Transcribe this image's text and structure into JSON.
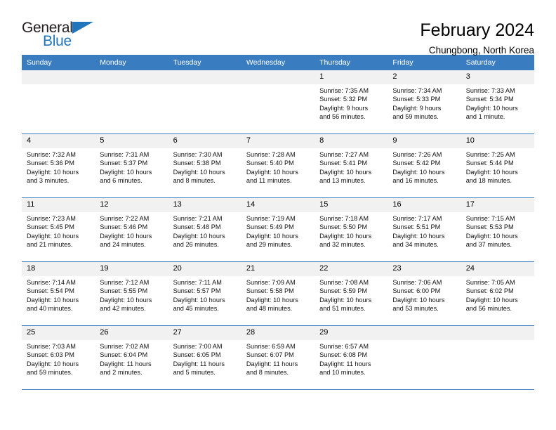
{
  "brand": {
    "name_top": "General",
    "name_bottom": "Blue",
    "triangle_color": "#2175bc"
  },
  "header": {
    "title": "February 2024",
    "subtitle": "Chungbong, North Korea"
  },
  "theme": {
    "header_blue": "#3a7cc0",
    "daynum_gray": "#f1f1f1"
  },
  "weekday_headers": [
    "Sunday",
    "Monday",
    "Tuesday",
    "Wednesday",
    "Thursday",
    "Friday",
    "Saturday"
  ],
  "weeks": [
    [
      {
        "day": "",
        "empty": true
      },
      {
        "day": "",
        "empty": true
      },
      {
        "day": "",
        "empty": true
      },
      {
        "day": "",
        "empty": true
      },
      {
        "day": "1",
        "sunrise": "Sunrise: 7:35 AM",
        "sunset": "Sunset: 5:32 PM",
        "daylight1": "Daylight: 9 hours",
        "daylight2": "and 56 minutes."
      },
      {
        "day": "2",
        "sunrise": "Sunrise: 7:34 AM",
        "sunset": "Sunset: 5:33 PM",
        "daylight1": "Daylight: 9 hours",
        "daylight2": "and 59 minutes."
      },
      {
        "day": "3",
        "sunrise": "Sunrise: 7:33 AM",
        "sunset": "Sunset: 5:34 PM",
        "daylight1": "Daylight: 10 hours",
        "daylight2": "and 1 minute."
      }
    ],
    [
      {
        "day": "4",
        "sunrise": "Sunrise: 7:32 AM",
        "sunset": "Sunset: 5:36 PM",
        "daylight1": "Daylight: 10 hours",
        "daylight2": "and 3 minutes."
      },
      {
        "day": "5",
        "sunrise": "Sunrise: 7:31 AM",
        "sunset": "Sunset: 5:37 PM",
        "daylight1": "Daylight: 10 hours",
        "daylight2": "and 6 minutes."
      },
      {
        "day": "6",
        "sunrise": "Sunrise: 7:30 AM",
        "sunset": "Sunset: 5:38 PM",
        "daylight1": "Daylight: 10 hours",
        "daylight2": "and 8 minutes."
      },
      {
        "day": "7",
        "sunrise": "Sunrise: 7:28 AM",
        "sunset": "Sunset: 5:40 PM",
        "daylight1": "Daylight: 10 hours",
        "daylight2": "and 11 minutes."
      },
      {
        "day": "8",
        "sunrise": "Sunrise: 7:27 AM",
        "sunset": "Sunset: 5:41 PM",
        "daylight1": "Daylight: 10 hours",
        "daylight2": "and 13 minutes."
      },
      {
        "day": "9",
        "sunrise": "Sunrise: 7:26 AM",
        "sunset": "Sunset: 5:42 PM",
        "daylight1": "Daylight: 10 hours",
        "daylight2": "and 16 minutes."
      },
      {
        "day": "10",
        "sunrise": "Sunrise: 7:25 AM",
        "sunset": "Sunset: 5:44 PM",
        "daylight1": "Daylight: 10 hours",
        "daylight2": "and 18 minutes."
      }
    ],
    [
      {
        "day": "11",
        "sunrise": "Sunrise: 7:23 AM",
        "sunset": "Sunset: 5:45 PM",
        "daylight1": "Daylight: 10 hours",
        "daylight2": "and 21 minutes."
      },
      {
        "day": "12",
        "sunrise": "Sunrise: 7:22 AM",
        "sunset": "Sunset: 5:46 PM",
        "daylight1": "Daylight: 10 hours",
        "daylight2": "and 24 minutes."
      },
      {
        "day": "13",
        "sunrise": "Sunrise: 7:21 AM",
        "sunset": "Sunset: 5:48 PM",
        "daylight1": "Daylight: 10 hours",
        "daylight2": "and 26 minutes."
      },
      {
        "day": "14",
        "sunrise": "Sunrise: 7:19 AM",
        "sunset": "Sunset: 5:49 PM",
        "daylight1": "Daylight: 10 hours",
        "daylight2": "and 29 minutes."
      },
      {
        "day": "15",
        "sunrise": "Sunrise: 7:18 AM",
        "sunset": "Sunset: 5:50 PM",
        "daylight1": "Daylight: 10 hours",
        "daylight2": "and 32 minutes."
      },
      {
        "day": "16",
        "sunrise": "Sunrise: 7:17 AM",
        "sunset": "Sunset: 5:51 PM",
        "daylight1": "Daylight: 10 hours",
        "daylight2": "and 34 minutes."
      },
      {
        "day": "17",
        "sunrise": "Sunrise: 7:15 AM",
        "sunset": "Sunset: 5:53 PM",
        "daylight1": "Daylight: 10 hours",
        "daylight2": "and 37 minutes."
      }
    ],
    [
      {
        "day": "18",
        "sunrise": "Sunrise: 7:14 AM",
        "sunset": "Sunset: 5:54 PM",
        "daylight1": "Daylight: 10 hours",
        "daylight2": "and 40 minutes."
      },
      {
        "day": "19",
        "sunrise": "Sunrise: 7:12 AM",
        "sunset": "Sunset: 5:55 PM",
        "daylight1": "Daylight: 10 hours",
        "daylight2": "and 42 minutes."
      },
      {
        "day": "20",
        "sunrise": "Sunrise: 7:11 AM",
        "sunset": "Sunset: 5:57 PM",
        "daylight1": "Daylight: 10 hours",
        "daylight2": "and 45 minutes."
      },
      {
        "day": "21",
        "sunrise": "Sunrise: 7:09 AM",
        "sunset": "Sunset: 5:58 PM",
        "daylight1": "Daylight: 10 hours",
        "daylight2": "and 48 minutes."
      },
      {
        "day": "22",
        "sunrise": "Sunrise: 7:08 AM",
        "sunset": "Sunset: 5:59 PM",
        "daylight1": "Daylight: 10 hours",
        "daylight2": "and 51 minutes."
      },
      {
        "day": "23",
        "sunrise": "Sunrise: 7:06 AM",
        "sunset": "Sunset: 6:00 PM",
        "daylight1": "Daylight: 10 hours",
        "daylight2": "and 53 minutes."
      },
      {
        "day": "24",
        "sunrise": "Sunrise: 7:05 AM",
        "sunset": "Sunset: 6:02 PM",
        "daylight1": "Daylight: 10 hours",
        "daylight2": "and 56 minutes."
      }
    ],
    [
      {
        "day": "25",
        "sunrise": "Sunrise: 7:03 AM",
        "sunset": "Sunset: 6:03 PM",
        "daylight1": "Daylight: 10 hours",
        "daylight2": "and 59 minutes."
      },
      {
        "day": "26",
        "sunrise": "Sunrise: 7:02 AM",
        "sunset": "Sunset: 6:04 PM",
        "daylight1": "Daylight: 11 hours",
        "daylight2": "and 2 minutes."
      },
      {
        "day": "27",
        "sunrise": "Sunrise: 7:00 AM",
        "sunset": "Sunset: 6:05 PM",
        "daylight1": "Daylight: 11 hours",
        "daylight2": "and 5 minutes."
      },
      {
        "day": "28",
        "sunrise": "Sunrise: 6:59 AM",
        "sunset": "Sunset: 6:07 PM",
        "daylight1": "Daylight: 11 hours",
        "daylight2": "and 8 minutes."
      },
      {
        "day": "29",
        "sunrise": "Sunrise: 6:57 AM",
        "sunset": "Sunset: 6:08 PM",
        "daylight1": "Daylight: 11 hours",
        "daylight2": "and 10 minutes."
      },
      {
        "day": "",
        "empty": true
      },
      {
        "day": "",
        "empty": true
      }
    ]
  ]
}
